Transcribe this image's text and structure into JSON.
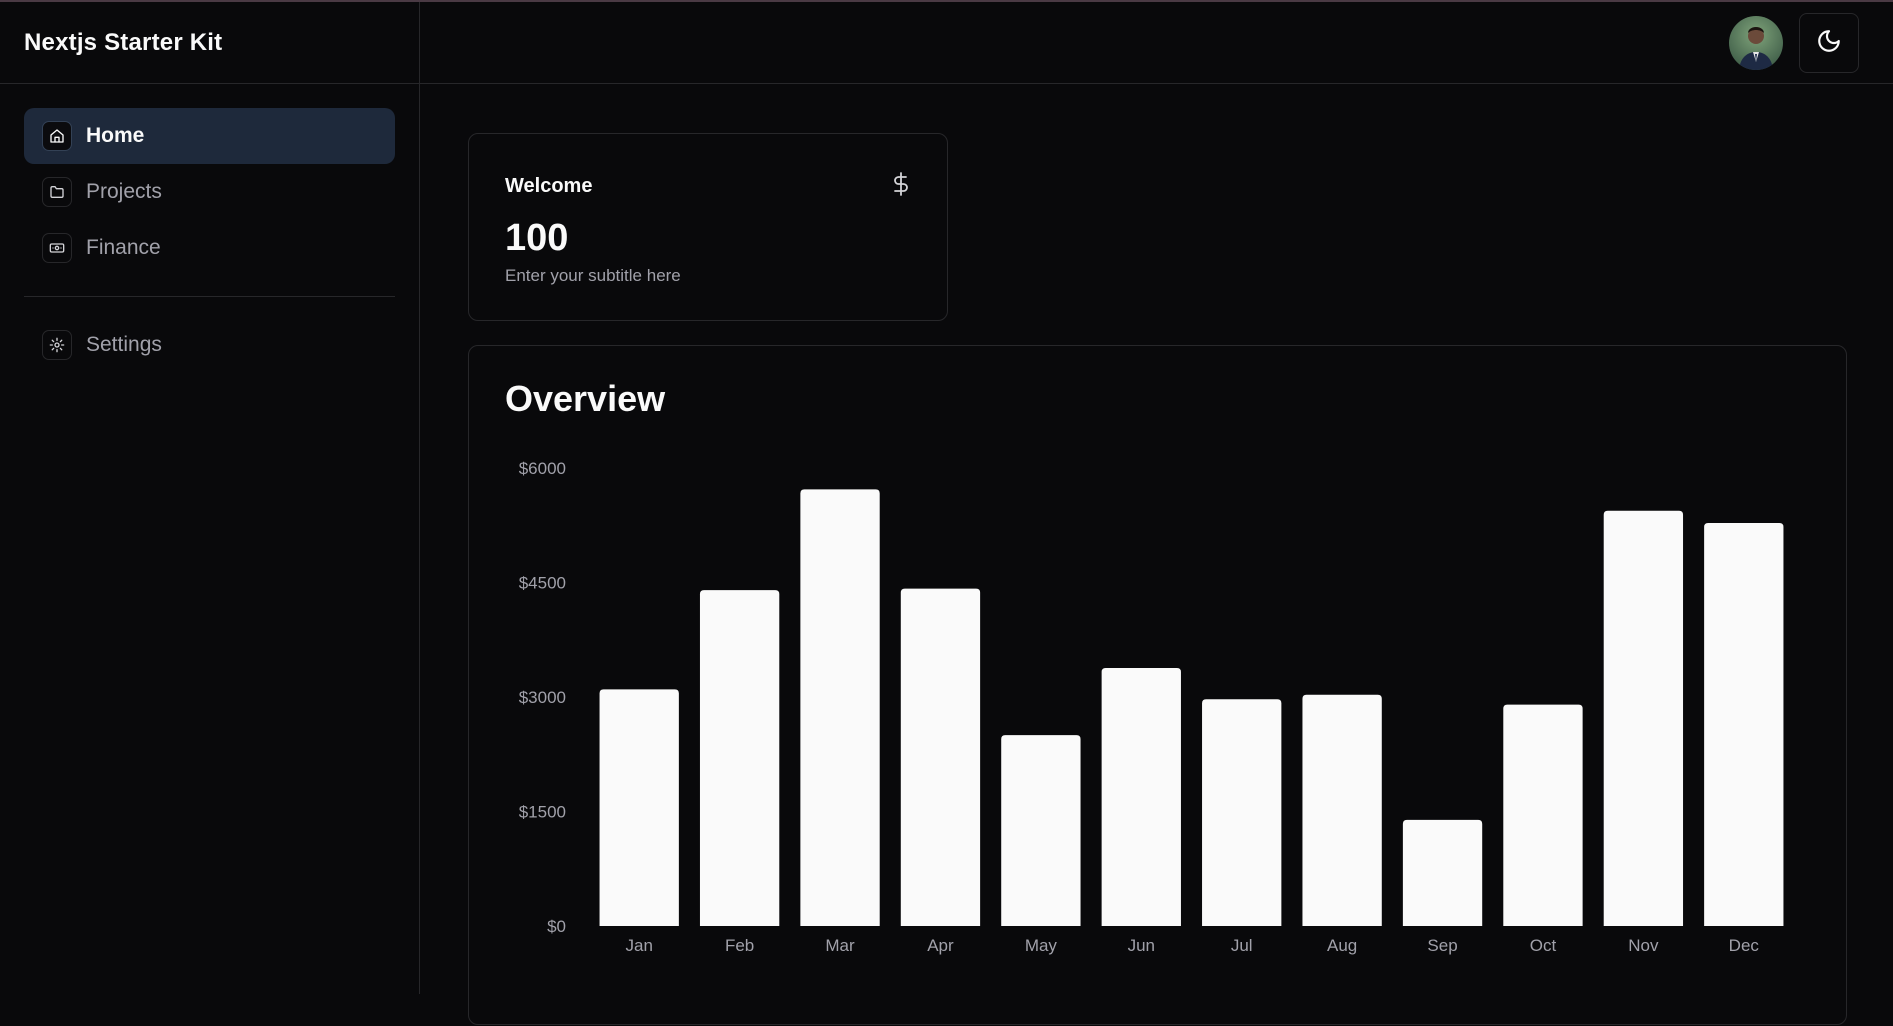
{
  "app": {
    "title": "Nextjs Starter Kit"
  },
  "sidebar": {
    "items": [
      {
        "label": "Home",
        "icon": "home-icon",
        "active": true
      },
      {
        "label": "Projects",
        "icon": "folder-icon",
        "active": false
      },
      {
        "label": "Finance",
        "icon": "banknote-icon",
        "active": false
      }
    ],
    "bottom_items": [
      {
        "label": "Settings",
        "icon": "gear-icon",
        "active": false
      }
    ]
  },
  "header": {
    "avatar": "user-avatar",
    "theme_toggle_icon": "moon-icon"
  },
  "welcome_card": {
    "title": "Welcome",
    "icon": "dollar-icon",
    "value": "100",
    "subtitle": "Enter your subtitle here"
  },
  "overview": {
    "title": "Overview"
  },
  "chart_data": {
    "type": "bar",
    "categories": [
      "Jan",
      "Feb",
      "Mar",
      "Apr",
      "May",
      "Jun",
      "Jul",
      "Aug",
      "Sep",
      "Oct",
      "Nov",
      "Dec"
    ],
    "values": [
      3100,
      4400,
      5720,
      4420,
      2500,
      3380,
      2970,
      3030,
      1390,
      2900,
      5440,
      5280
    ],
    "yticks": [
      "$0",
      "$1500",
      "$3000",
      "$4500",
      "$6000"
    ],
    "ytick_values": [
      0,
      1500,
      3000,
      4500,
      6000
    ],
    "ylim": [
      0,
      6000
    ],
    "grid": false,
    "bar_color": "#fafafa"
  },
  "colors": {
    "background": "#09090b",
    "border": "#27272a",
    "active_nav": "#1e293b",
    "muted_text": "#a1a1aa"
  }
}
